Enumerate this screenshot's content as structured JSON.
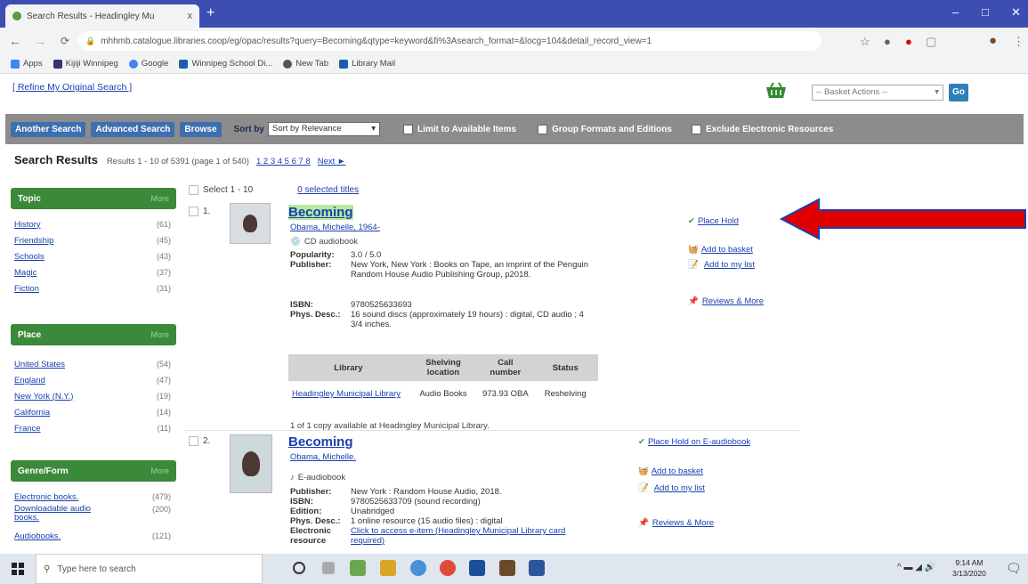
{
  "browser": {
    "tab_title": "Search Results - Headingley Mu",
    "tab_close": "x",
    "new_tab": "+",
    "url": "mhhmb.catalogue.libraries.coop/eg/opac/results?query=Becoming&qtype=keyword&fi%3Asearch_format=&locg=104&detail_record_view=1",
    "window_controls": [
      "–",
      "□",
      "✕"
    ],
    "bookmarks": [
      {
        "label": "Apps",
        "icon": "apps-grid-icon",
        "color": "#4285f4"
      },
      {
        "label": "Kijiji Winnipeg",
        "icon": "kijiji-icon",
        "color": "#373373"
      },
      {
        "label": "Google",
        "icon": "google-icon",
        "color": "#4285f4"
      },
      {
        "label": "Winnipeg School Di...",
        "icon": "school-icon",
        "color": "#1a5ea8"
      },
      {
        "label": "New Tab",
        "icon": "globe-icon",
        "color": "#555"
      },
      {
        "label": "Library Mail",
        "icon": "mail-icon",
        "color": "#1a5ea8"
      }
    ]
  },
  "page": {
    "refine_link": "[ Refine My Original Search ]",
    "basket_actions": "-- Basket Actions --",
    "go": "Go",
    "toolbar": {
      "another_search": "Another Search",
      "advanced_search": "Advanced Search",
      "browse": "Browse",
      "sort_by": "Sort by",
      "sort_value": "Sort by Relevance",
      "limit_available": "Limit to Available Items",
      "group_formats": "Group Formats and Editions",
      "exclude_electronic": "Exclude Electronic Resources"
    },
    "results_header": {
      "title": "Search Results",
      "meta": "Results 1 - 10 of 5391 (page 1 of 540)",
      "pages": "1 2 3 4 5 6 7 8",
      "next": "Next ►"
    },
    "select_label": "Select 1 - 10",
    "selected_titles": "0 selected titles"
  },
  "facets": [
    {
      "title": "Topic",
      "more": "More",
      "items": [
        {
          "label": "History",
          "count": "(61)"
        },
        {
          "label": "Friendship",
          "count": "(45)"
        },
        {
          "label": "Schools",
          "count": "(43)"
        },
        {
          "label": "Magic",
          "count": "(37)"
        },
        {
          "label": "Fiction",
          "count": "(31)"
        }
      ]
    },
    {
      "title": "Place",
      "more": "More",
      "items": [
        {
          "label": "United States",
          "count": "(54)"
        },
        {
          "label": "England",
          "count": "(47)"
        },
        {
          "label": "New York (N.Y.)",
          "count": "(19)"
        },
        {
          "label": "California",
          "count": "(14)"
        },
        {
          "label": "France",
          "count": "(11)"
        }
      ]
    },
    {
      "title": "Genre/Form",
      "more": "More",
      "items": [
        {
          "label": "Electronic books.",
          "count": "(479)"
        },
        {
          "label": "Downloadable audio books.",
          "count": "(200)"
        },
        {
          "label": "Audiobooks.",
          "count": "(121)"
        }
      ]
    }
  ],
  "results": [
    {
      "num": "1.",
      "title": "Becoming",
      "author": "Obama, Michelle, 1964-",
      "format": "CD audiobook",
      "popularity_k": "Popularity:",
      "popularity_v": "3.0 / 5.0",
      "publisher_k": "Publisher:",
      "publisher_v": "New York, New York : Books on Tape, an imprint of the Penguin Random House Audio Publishing Group, p2018.",
      "isbn_k": "ISBN:",
      "isbn_v": "9780525633693",
      "phys_k": "Phys. Desc.:",
      "phys_v": "16 sound discs (approximately 19 hours) : digital, CD audio ; 4 3/4 inches.",
      "holdings_headers": [
        "Library",
        "Shelving location",
        "Call number",
        "Status"
      ],
      "holdings_row": [
        "Headingley Municipal Library",
        "Audio Books",
        "973.93 OBA",
        "Reshelving"
      ],
      "copies": "1 of 1 copy available at Headingley Municipal Library.",
      "actions": [
        "Place Hold",
        "Add to basket",
        "Add to my list",
        "Reviews & More"
      ]
    },
    {
      "num": "2.",
      "title": "Becoming",
      "author": "Obama, Michelle.",
      "format": "E-audiobook",
      "publisher_k": "Publisher:",
      "publisher_v": "New York : Random House Audio, 2018.",
      "isbn_k": "ISBN:",
      "isbn_v": "9780525633709 (sound recording)",
      "edition_k": "Edition:",
      "edition_v": "Unabridged",
      "phys_k": "Phys. Desc.:",
      "phys_v": "1 online resource (15 audio files) : digital",
      "elec_k": "Electronic resource",
      "elec_v": "Click to access e-item (Headingley Municipal Library card required)",
      "actions": [
        "Place Hold on E-audiobook",
        "Add to basket",
        "Add to my list",
        "Reviews & More"
      ]
    }
  ],
  "taskbar": {
    "search_placeholder": "Type here to search",
    "time": "9:14 AM",
    "date": "3/13/2020"
  },
  "colors": {
    "facet_green": "#3a8a3a",
    "link": "#1a3fb0",
    "arrow_red": "#e00000",
    "toolbar_gray": "#8c8c8c"
  }
}
